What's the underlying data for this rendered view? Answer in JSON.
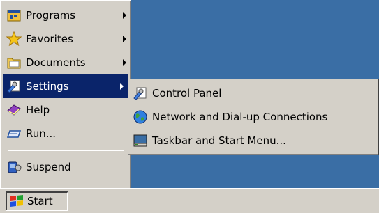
{
  "start_menu": {
    "items": [
      {
        "label": "Programs",
        "icon": "programs-icon",
        "has_submenu": true
      },
      {
        "label": "Favorites",
        "icon": "favorites-icon",
        "has_submenu": true
      },
      {
        "label": "Documents",
        "icon": "documents-icon",
        "has_submenu": true
      },
      {
        "label": "Settings",
        "icon": "settings-icon",
        "has_submenu": true,
        "selected": true
      },
      {
        "label": "Help",
        "icon": "help-icon",
        "has_submenu": false
      },
      {
        "label": "Run...",
        "icon": "run-icon",
        "has_submenu": false
      },
      {
        "label": "Suspend",
        "icon": "suspend-icon",
        "has_submenu": false
      }
    ]
  },
  "settings_submenu": {
    "items": [
      {
        "label": "Control Panel",
        "icon": "control-panel-icon"
      },
      {
        "label": "Network and Dial-up Connections",
        "icon": "network-icon"
      },
      {
        "label": "Taskbar and Start Menu...",
        "icon": "taskbar-icon"
      }
    ]
  },
  "taskbar": {
    "start_label": "Start"
  },
  "colors": {
    "desktop": "#3a6ea5",
    "menu_face": "#d4d0c8",
    "highlight": "#0a246a"
  }
}
